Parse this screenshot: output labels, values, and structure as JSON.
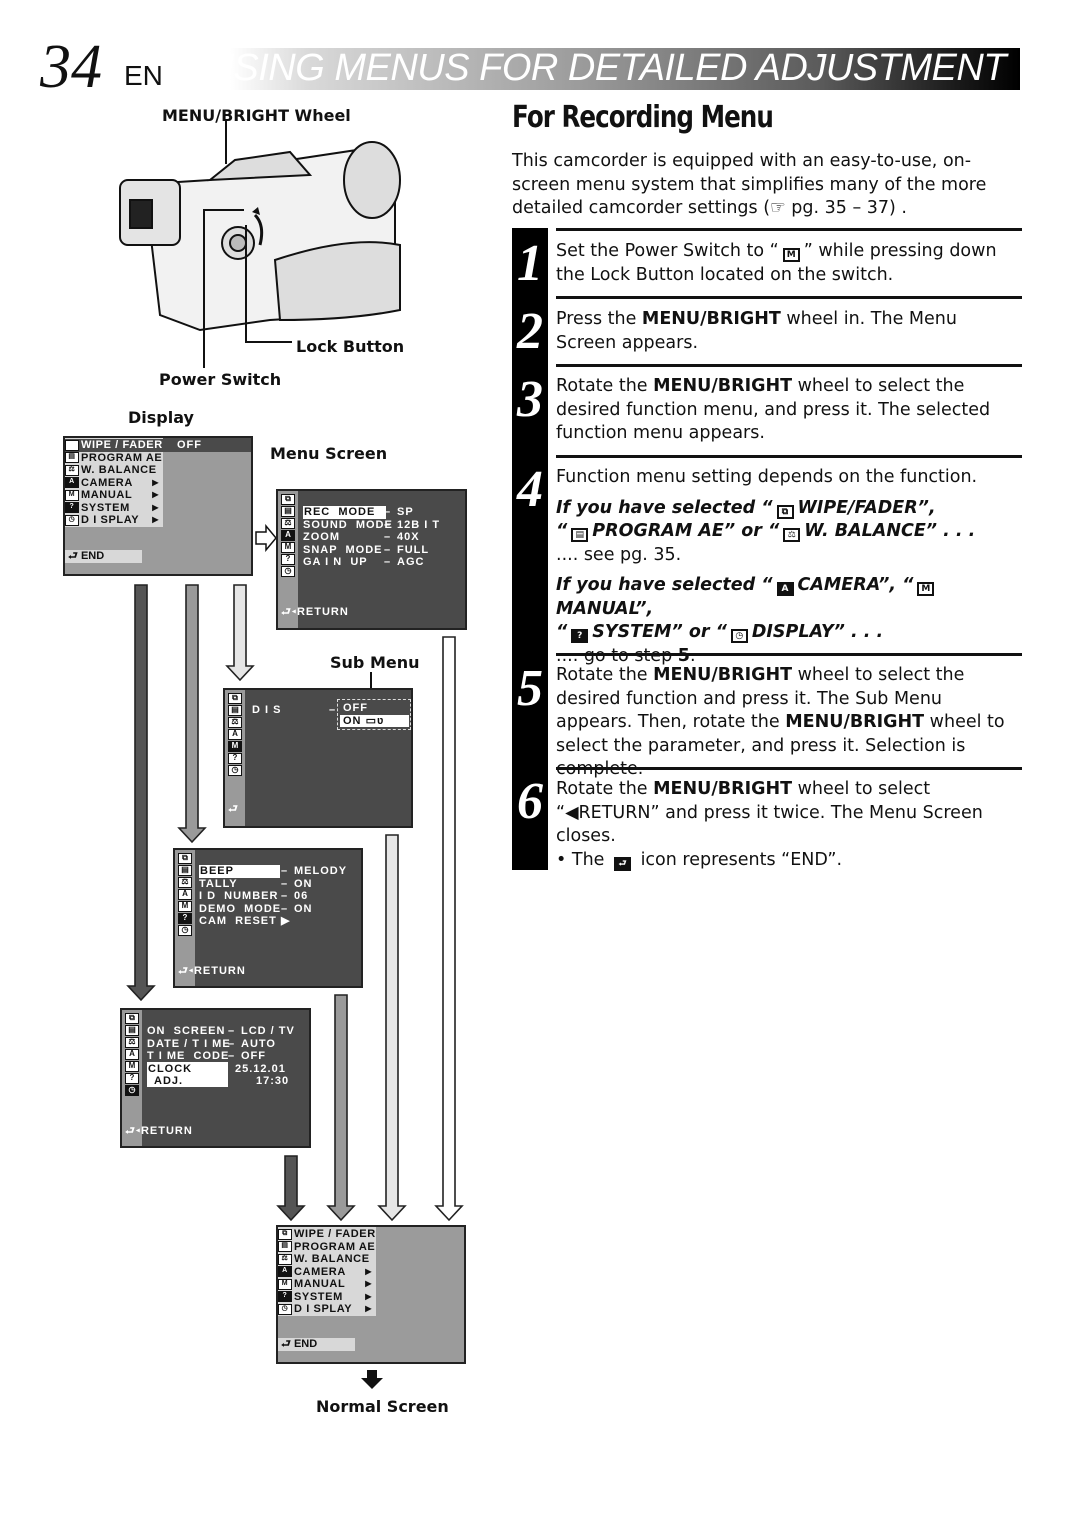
{
  "header": {
    "page_number": "34",
    "language": "EN",
    "section_title": "USING MENUS FOR DETAILED ADJUSTMENT"
  },
  "diagram": {
    "labels": {
      "menu_bright_wheel": "MENU/BRIGHT Wheel",
      "lock_button": "Lock Button",
      "power_switch": "Power Switch",
      "display": "Display",
      "menu_screen": "Menu Screen",
      "sub_menu": "Sub Menu",
      "normal_screen": "Normal Screen"
    },
    "main_menu": {
      "items": [
        {
          "icon": "wipe-fader-icon",
          "label": "WIPE / FADER",
          "value": "OFF",
          "arrow": false
        },
        {
          "icon": "program-ae-icon",
          "label": "PROGRAM  AE",
          "value": "",
          "arrow": false
        },
        {
          "icon": "white-balance-icon",
          "label": "W. BALANCE",
          "value": "",
          "arrow": false
        },
        {
          "icon": "camera-icon",
          "label": "CAMERA",
          "value": "",
          "arrow": true
        },
        {
          "icon": "manual-icon",
          "label": "MANUAL",
          "value": "",
          "arrow": true
        },
        {
          "icon": "system-icon",
          "label": "SYSTEM",
          "value": "",
          "arrow": true
        },
        {
          "icon": "display-icon",
          "label": "D I SPLAY",
          "value": "",
          "arrow": true
        }
      ],
      "end_label": "END"
    },
    "camera_menu": {
      "rows": [
        {
          "label": "REC  MODE",
          "value": "SP",
          "selected": true
        },
        {
          "label": "SOUND  MODE",
          "value": "12B I T",
          "selected": false
        },
        {
          "label": "ZOOM",
          "value": "40X",
          "selected": false
        },
        {
          "label": "SNAP  MODE",
          "value": "FULL",
          "selected": false
        },
        {
          "label": "GA I N  UP",
          "value": "AGC",
          "selected": false
        }
      ],
      "return_label": "RETURN"
    },
    "manual_menu": {
      "label": "D I S",
      "options": [
        {
          "label": "OFF",
          "selected": false
        },
        {
          "label": "ON",
          "selected": true
        }
      ]
    },
    "system_menu": {
      "rows": [
        {
          "label": "BEEP",
          "sep": "–",
          "value": "MELODY",
          "selected": true
        },
        {
          "label": "TALLY",
          "sep": "–",
          "value": "ON",
          "selected": false
        },
        {
          "label": "I D  NUMBER",
          "sep": "–",
          "value": "06",
          "selected": false
        },
        {
          "label": "DEMO  MODE",
          "sep": "–",
          "value": "ON",
          "selected": false
        },
        {
          "label": "CAM  RESET",
          "sep": "▶",
          "value": "",
          "selected": false
        }
      ],
      "return_label": "RETURN"
    },
    "display_menu": {
      "rows": [
        {
          "label": "ON  SCREEN",
          "sep": "–",
          "value": "LCD / TV"
        },
        {
          "label": "DATE / T I ME",
          "sep": "–",
          "value": "AUTO"
        },
        {
          "label": "T I ME  CODE",
          "sep": "–",
          "value": "OFF"
        }
      ],
      "clock_label_1": "CLOCK",
      "clock_label_2": "ADJ.",
      "clock_date": "25.12.01",
      "clock_time": "17:30",
      "return_label": "RETURN"
    },
    "normal_menu": {
      "items": [
        {
          "label": "WIPE / FADER",
          "arrow": false
        },
        {
          "label": "PROGRAM  AE",
          "arrow": false
        },
        {
          "label": "W. BALANCE",
          "arrow": false
        },
        {
          "label": "CAMERA",
          "arrow": true
        },
        {
          "label": "MANUAL",
          "arrow": true
        },
        {
          "label": "SYSTEM",
          "arrow": true
        },
        {
          "label": "D I SPLAY",
          "arrow": true
        }
      ],
      "end_label": "END"
    }
  },
  "instructions": {
    "title": "For Recording Menu",
    "intro": "This camcorder is equipped with an easy-to-use, on-screen menu system that simplifies many of the more detailed camcorder settings (☞ pg. 35 – 37) .",
    "steps": [
      {
        "number": "1",
        "text_a": "Set the Power Switch to “",
        "glyph": "M",
        "text_b": "” while pressing down the Lock Button located on the switch."
      },
      {
        "number": "2",
        "pre": "Press the ",
        "bold": "MENU/BRIGHT",
        "post": " wheel in. The Menu Screen appears."
      },
      {
        "number": "3",
        "pre": "Rotate the ",
        "bold": "MENU/BRIGHT",
        "post": " wheel to select the desired function menu, and press it. The selected function menu appears."
      },
      {
        "number": "4",
        "text": "Function menu setting depends on the function.",
        "case1_a": "If you have selected “",
        "case1_w": "WIPE/FADER”,",
        "case1_b": "“",
        "case1_p": "PROGRAM AE” or “",
        "case1_wb": "W. BALANCE” . . .",
        "case1_ref": ".... see pg. 35.",
        "case2_a": "If you have selected “",
        "case2_cam": "CAMERA”, “",
        "case2_man": "MANUAL”,",
        "case2_q": "“",
        "case2_sys": "SYSTEM” or “",
        "case2_disp": "DISPLAY” . . .",
        "case2_ref_pre": ".... go to step ",
        "case2_ref_num": "5",
        "case2_ref_post": "."
      },
      {
        "number": "5",
        "pre": "Rotate the ",
        "bold": "MENU/BRIGHT",
        "mid": " wheel to select the desired function and press it. The Sub Menu appears. Then, rotate the ",
        "bold2": "MENU/BRIGHT",
        "post": " wheel to select the parameter, and press it. Selection is complete."
      },
      {
        "number": "6",
        "pre": "Rotate the ",
        "bold": "MENU/BRIGHT",
        "post": " wheel to select “◀RETURN” and press it twice. The Menu Screen closes.",
        "note_pre": "• The ",
        "note_post": " icon represents “END”."
      }
    ]
  }
}
